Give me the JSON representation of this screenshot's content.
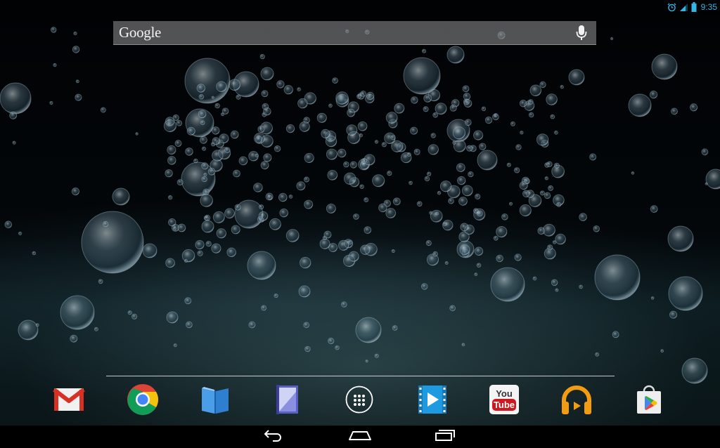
{
  "status_bar": {
    "time": "9:35",
    "icons": [
      "alarm-icon",
      "signal-icon",
      "battery-icon"
    ]
  },
  "search_bar": {
    "label": "Google",
    "icon": "microphone-icon"
  },
  "dock": {
    "apps": [
      {
        "name": "Gmail",
        "icon": "gmail-icon"
      },
      {
        "name": "Chrome",
        "icon": "chrome-icon"
      },
      {
        "name": "Play Books",
        "icon": "play-books-icon"
      },
      {
        "name": "Play Magazines",
        "icon": "play-magazines-icon"
      },
      {
        "name": "All Apps",
        "icon": "app-drawer-icon"
      },
      {
        "name": "Play Movies",
        "icon": "play-movies-icon"
      },
      {
        "name": "YouTube",
        "icon": "youtube-icon",
        "logo_text_top": "You",
        "logo_text_bottom": "Tube"
      },
      {
        "name": "Play Music",
        "icon": "headphones-icon"
      },
      {
        "name": "Play Store",
        "icon": "play-store-icon"
      }
    ]
  },
  "nav_bar": {
    "buttons": [
      {
        "name": "back",
        "icon": "back-arrow-icon"
      },
      {
        "name": "home",
        "icon": "home-icon"
      },
      {
        "name": "recents",
        "icon": "recent-apps-icon"
      }
    ]
  },
  "colors": {
    "accent": "#33b5e5",
    "gmail_red": "#d93025",
    "youtube_red": "#cc181e",
    "music_orange": "#f39c12",
    "movies_blue": "#1e9be0",
    "books_blue": "#4a9ee8"
  }
}
